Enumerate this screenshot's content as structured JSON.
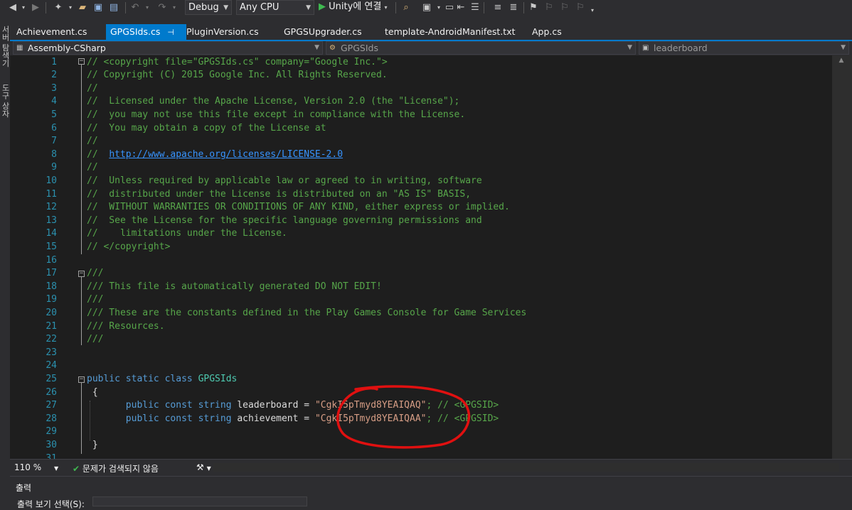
{
  "toolbar": {
    "configuration": "Debug",
    "platform": "Any CPU",
    "run_label": "Unity에 연결"
  },
  "side_strip": {
    "items": [
      "서버 탐색기",
      "도구 상자"
    ]
  },
  "tabs": [
    {
      "label": "Achievement.cs",
      "active": false
    },
    {
      "label": "GPGSIds.cs",
      "active": true
    },
    {
      "label": "PluginVersion.cs",
      "active": false
    },
    {
      "label": "GPGSUpgrader.cs",
      "active": false
    },
    {
      "label": "template-AndroidManifest.txt",
      "active": false
    },
    {
      "label": "App.cs",
      "active": false
    }
  ],
  "navbar": {
    "project": "Assembly-CSharp",
    "type": "GPGSIds",
    "member": "leaderboard"
  },
  "code_lines": [
    {
      "n": "1",
      "text": "// <copyright file=\"GPGSIds.cs\" company=\"Google Inc.\">"
    },
    {
      "n": "2",
      "text": "// Copyright (C) 2015 Google Inc. All Rights Reserved."
    },
    {
      "n": "3",
      "text": "//"
    },
    {
      "n": "4",
      "text": "//  Licensed under the Apache License, Version 2.0 (the \"License\");"
    },
    {
      "n": "5",
      "text": "//  you may not use this file except in compliance with the License."
    },
    {
      "n": "6",
      "text": "//  You may obtain a copy of the License at"
    },
    {
      "n": "7",
      "text": "//"
    },
    {
      "n": "8",
      "prefix": "//  ",
      "url": "http://www.apache.org/licenses/LICENSE-2.0"
    },
    {
      "n": "9",
      "text": "//"
    },
    {
      "n": "10",
      "text": "//  Unless required by applicable law or agreed to in writing, software"
    },
    {
      "n": "11",
      "text": "//  distributed under the License is distributed on an \"AS IS\" BASIS,"
    },
    {
      "n": "12",
      "text": "//  WITHOUT WARRANTIES OR CONDITIONS OF ANY KIND, either express or implied."
    },
    {
      "n": "13",
      "text": "//  See the License for the specific language governing permissions and"
    },
    {
      "n": "14",
      "text": "//    limitations under the License."
    },
    {
      "n": "15",
      "text": "// </copyright>"
    },
    {
      "n": "16",
      "text": ""
    },
    {
      "n": "17",
      "text": "///"
    },
    {
      "n": "18",
      "text": "/// This file is automatically generated DO NOT EDIT!"
    },
    {
      "n": "19",
      "text": "///"
    },
    {
      "n": "20",
      "text": "/// These are the constants defined in the Play Games Console for Game Services"
    },
    {
      "n": "21",
      "text": "/// Resources."
    },
    {
      "n": "22",
      "text": "///"
    },
    {
      "n": "23",
      "text": ""
    },
    {
      "n": "24",
      "text": ""
    },
    {
      "n": "25",
      "kw1": "public",
      "kw2": "static",
      "kw3": "class",
      "type": "GPGSIds"
    },
    {
      "n": "26",
      "text": "{"
    },
    {
      "n": "27",
      "kw1": "public",
      "kw2": "const",
      "kw3": "string",
      "name": "leaderboard",
      "eq": " = ",
      "str": "\"CgkI5pTmyd8YEAIQAQ\"",
      "tail": "; // <GPGSID>"
    },
    {
      "n": "28",
      "kw1": "public",
      "kw2": "const",
      "kw3": "string",
      "name": "achievement",
      "eq": " = ",
      "str": "\"CgkI5pTmyd8YEAIQAA\"",
      "tail": "; // <GPGSID>"
    },
    {
      "n": "29",
      "text": ""
    },
    {
      "n": "30",
      "text": "}"
    },
    {
      "n": "31",
      "text": ""
    }
  ],
  "status": {
    "zoom": "110 %",
    "issues": "문제가 검색되지 않음"
  },
  "output_panel": {
    "title": "출력",
    "source_label": "출력 보기 선택(S):"
  },
  "colors": {
    "accent": "#007acc",
    "editor_bg": "#1e1e1e",
    "comment": "#57a64a",
    "keyword": "#569cd6",
    "type": "#4ec9b0",
    "string": "#d69d85",
    "line_number": "#2b91af",
    "annotation": "#e01010"
  }
}
